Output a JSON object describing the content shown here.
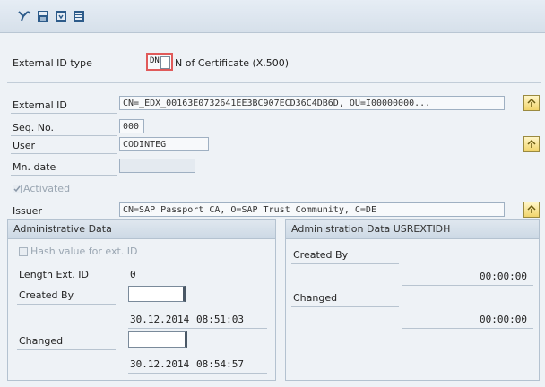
{
  "toolbar": {
    "icons": [
      "glasses-toggle-icon",
      "save-icon",
      "save-local-icon",
      "layout-icon"
    ]
  },
  "ext_id_type": {
    "label": "External ID type",
    "code": "DN",
    "description": "N of Certificate (X.500)"
  },
  "form": {
    "external_id": {
      "label": "External ID",
      "value": "CN=_EDX_00163E0732641EE3BC907ECD36C4DB6D, OU=I00000000..."
    },
    "seq_no": {
      "label": "Seq. No.",
      "value": "000"
    },
    "user": {
      "label": "User",
      "value": "CODINTEG"
    },
    "min_date": {
      "label": "Mn. date",
      "value": ""
    },
    "activated": {
      "label": "Activated",
      "checked": true
    },
    "issuer": {
      "label": "Issuer",
      "value": "CN=SAP Passport CA, O=SAP Trust Community, C=DE"
    }
  },
  "admin_data": {
    "title": "Administrative Data",
    "hash_label": "Hash value for ext. ID",
    "length_label": "Length Ext. ID",
    "length_value": "0",
    "created_by_label": "Created By",
    "created_by_value": "",
    "created_date": "30.12.2014",
    "created_time": "08:51:03",
    "changed_label": "Changed",
    "changed_value": "",
    "changed_date": "30.12.2014",
    "changed_time": "08:54:57"
  },
  "admin_data_usrextidh": {
    "title": "Administration Data USREXTIDH",
    "created_by_label": "Created By",
    "created_time": "00:00:00",
    "changed_label": "Changed",
    "changed_time": "00:00:00"
  },
  "colors": {
    "accent": "#f1d46b",
    "panel_head": "#cdd9e5",
    "background": "#eef2f6"
  }
}
